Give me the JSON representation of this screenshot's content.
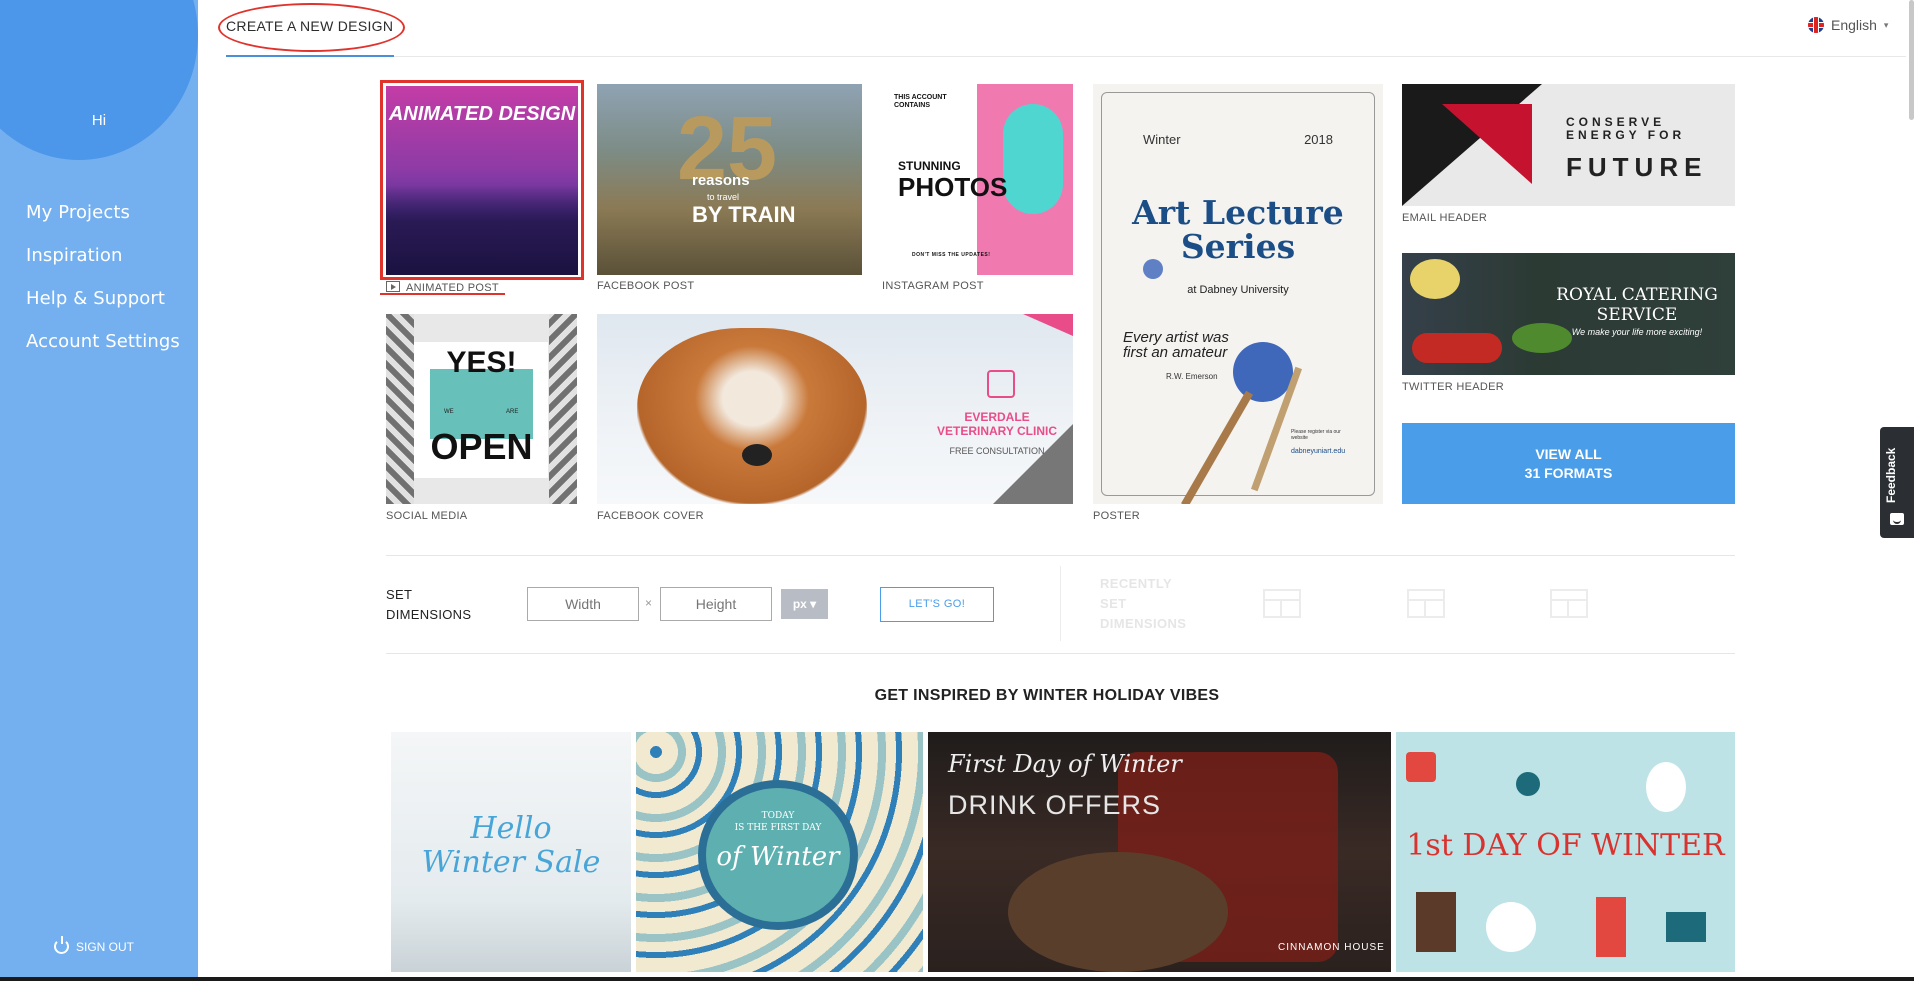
{
  "sidebar": {
    "greeting": "Hi",
    "items": [
      {
        "label": "My Projects"
      },
      {
        "label": "Inspiration"
      },
      {
        "label": "Help & Support"
      },
      {
        "label": "Account Settings"
      }
    ],
    "signout_label": "SIGN OUT"
  },
  "header": {
    "tab_label": "CREATE A NEW DESIGN",
    "language": "English"
  },
  "formats": {
    "animated_post": {
      "caption": "ANIMATED POST",
      "art": "ANIMATED DESIGN"
    },
    "facebook_post": {
      "caption": "FACEBOOK POST",
      "num": "25",
      "line1": "reasons",
      "line2": "to travel",
      "line3": "BY TRAIN"
    },
    "instagram_post": {
      "caption": "INSTAGRAM POST",
      "small": "THIS ACCOUNT CONTAINS",
      "line1": "STUNNING",
      "line2": "PHOTOS",
      "foot": "DON'T MISS THE UPDATES!"
    },
    "poster": {
      "caption": "POSTER",
      "season": "Winter",
      "year": "2018",
      "title": "Art Lecture Series",
      "venue": "at Dabney University",
      "quote": "Every artist was first an amateur",
      "author": "R.W. Emerson",
      "register": "Please register via our website",
      "url": "dabneyuniart.edu"
    },
    "email_header": {
      "caption": "EMAIL HEADER",
      "line1": "CONSERVE ENERGY FOR",
      "line2": "FUTURE"
    },
    "twitter_header": {
      "caption": "TWITTER HEADER",
      "title": "ROYAL CATERING SERVICE",
      "tagline": "We make your life more exciting!"
    },
    "social_media": {
      "caption": "SOCIAL MEDIA",
      "yes": "YES!",
      "we": "WE",
      "are": "ARE",
      "open": "OPEN"
    },
    "facebook_cover": {
      "caption": "FACEBOOK COVER",
      "title": "EVERDALE VETERINARY CLINIC",
      "sub": "FREE CONSULTATION"
    },
    "view_all": {
      "line1": "VIEW ALL",
      "line2": "31 FORMATS"
    }
  },
  "dimensions": {
    "label_line1": "SET",
    "label_line2": "DIMENSIONS",
    "width_placeholder": "Width",
    "height_placeholder": "Height",
    "times": "×",
    "unit": "px",
    "go_label": "LET'S GO!",
    "recent_line1": "RECENTLY",
    "recent_line2": "SET",
    "recent_line3": "DIMENSIONS"
  },
  "inspired": {
    "title": "GET INSPIRED BY WINTER HOLIDAY VIBES",
    "cards": [
      {
        "text": "Hello Winter Sale"
      },
      {
        "line1": "TODAY",
        "line2": "IS THE FIRST DAY",
        "line3": "of Winter"
      },
      {
        "line1": "First Day of Winter",
        "line2": "DRINK OFFERS",
        "logo": "CINNAMON HOUSE"
      },
      {
        "text": "1st DAY OF WINTER"
      }
    ]
  },
  "feedback": {
    "label": "Feedback"
  },
  "colors": {
    "sidebar": "#74b0ef",
    "accent": "#4a9de8",
    "highlight": "#e0332b"
  }
}
